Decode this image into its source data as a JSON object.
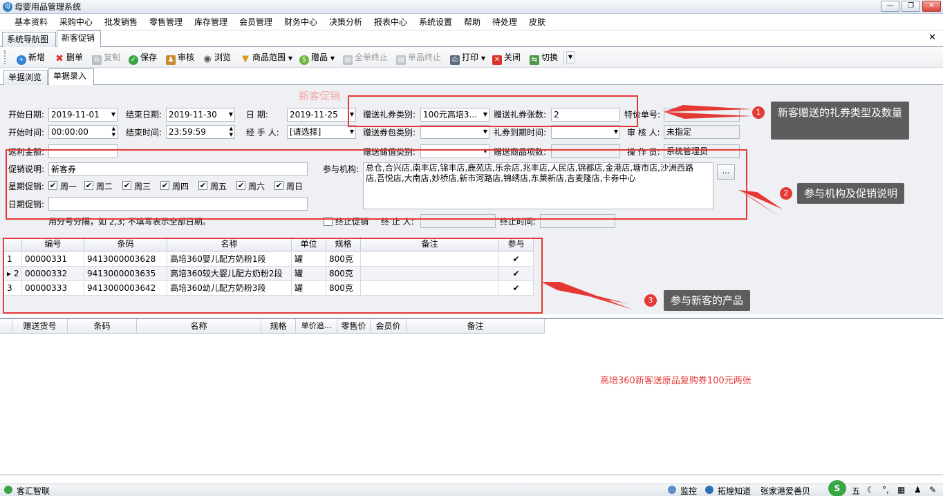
{
  "window": {
    "title": "母婴用品管理系统",
    "min": "—",
    "max": "❐",
    "close": "✕"
  },
  "menu": [
    "基本资料",
    "采购中心",
    "批发销售",
    "零售管理",
    "库存管理",
    "会员管理",
    "财务中心",
    "决策分析",
    "报表中心",
    "系统设置",
    "帮助",
    "待处理",
    "皮肤"
  ],
  "tabs": [
    "系统导航图",
    "新客促销"
  ],
  "toolbar": {
    "new": "新增",
    "delete": "删单",
    "copy": "复制",
    "save": "保存",
    "audit": "审核",
    "browse": "浏览",
    "range": "商品范围",
    "gift": "赠品",
    "end_all": "全单终止",
    "end_item": "单品终止",
    "print": "打印",
    "close": "关闭",
    "switch": "切换"
  },
  "subtabs": [
    "单据浏览",
    "单据录入"
  ],
  "watermark_title": "新客促销",
  "form": {
    "start_date_label": "开始日期:",
    "start_date": "2019-11-01",
    "end_date_label": "结束日期:",
    "end_date": "2019-11-30",
    "date_label": "日    期:",
    "date": "2019-11-25",
    "coupon_type_label": "赠送礼券类别:",
    "coupon_type": "100元高培3...",
    "coupon_count_label": "赠送礼券张数:",
    "coupon_count": "2",
    "price_no_label": "特价单号:",
    "price_no": "",
    "start_time_label": "开始时间:",
    "start_time": "00:00:00",
    "end_time_label": "结束时间:",
    "end_time": "23:59:59",
    "handler_label": "经 手 人:",
    "handler": "[请选择]",
    "coupon_pack_label": "赠送券包类别:",
    "coupon_pack": "",
    "coupon_expire_label": "礼券到期时间:",
    "coupon_expire": "",
    "auditor_label": "审 核 人:",
    "auditor": "未指定",
    "rebate_label": "返利金额:",
    "rebate": "",
    "stored_value_label": "赠送储值类别:",
    "stored_value": "",
    "gift_items_label": "赠送商品项数:",
    "gift_items": "",
    "operator_label": "操 作 员:",
    "operator": "系统管理员",
    "desc_label": "促销说明:",
    "desc": "新客券",
    "orgs_label": "参与机构:",
    "orgs": "总仓,合兴店,南丰店,锦丰店,鹿苑店,乐余店,兆丰店,人民店,锦都店,金港店,塘市店,沙洲西路店,吾悦店,大南店,妙桥店,新市河路店,锦绣店,东莱新店,吉麦隆店,卡券中心",
    "orgs_btn": "...",
    "week_label": "星期促销:",
    "weekdays": [
      "周一",
      "周二",
      "周三",
      "周四",
      "周五",
      "周六",
      "周日"
    ],
    "day_label": "日期促销:",
    "day": "",
    "hint": "用分号分隔，如 2,3; 不填写表示全部日期。",
    "terminate_label": "终止促销",
    "terminator_label": "终 止 人:",
    "terminator": "",
    "terminate_time_label": "终止时间:",
    "terminate_time": ""
  },
  "grid1": {
    "headers": [
      "编号",
      "条码",
      "名称",
      "单位",
      "规格",
      "备注",
      "参与"
    ],
    "rows": [
      {
        "idx": "1",
        "code": "00000331",
        "barcode": "9413000003628",
        "name": "高培360婴儿配方奶粉1段",
        "unit": "罐",
        "spec": "800克",
        "note": "",
        "join": "✔"
      },
      {
        "idx": "2",
        "code": "00000332",
        "barcode": "9413000003635",
        "name": "高培360较大婴儿配方奶粉2段",
        "unit": "罐",
        "spec": "800克",
        "note": "",
        "join": "✔"
      },
      {
        "idx": "3",
        "code": "00000333",
        "barcode": "9413000003642",
        "name": "高培360幼儿配方奶粉3段",
        "unit": "罐",
        "spec": "800克",
        "note": "",
        "join": "✔"
      }
    ]
  },
  "grid2": {
    "headers": [
      "赠送货号",
      "条码",
      "名称",
      "规格",
      "单价追...",
      "零售价",
      "会员价",
      "备注"
    ]
  },
  "annotations": {
    "note_red": "高培360新客送原品复购券100元两张",
    "callout1": "新客赠送的礼券类型及数量",
    "n1": "1",
    "callout2": "参与机构及促销说明",
    "n2": "2",
    "callout3": "参与新客的产品",
    "n3": "3"
  },
  "status": {
    "left": "客汇智联",
    "monitor": "监控",
    "tuohuang": "拓煌知道",
    "store": "张家港爱善贝",
    "ime": "五"
  }
}
